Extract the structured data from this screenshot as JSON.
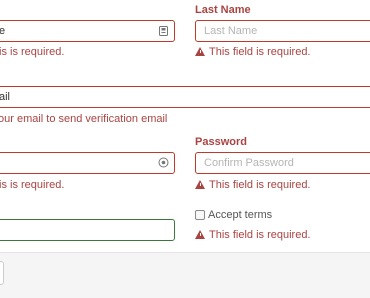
{
  "form": {
    "first_name": {
      "value": "e",
      "error": "is is required.",
      "icon": "id-card-icon"
    },
    "last_name": {
      "label": "Last Name",
      "placeholder": "Last Name",
      "error": "This field is required."
    },
    "email": {
      "value": "ail",
      "error": "our email to send verification email"
    },
    "password": {
      "value": "",
      "error": "is is required.",
      "icon": "eye-icon"
    },
    "confirm_password": {
      "label": "Password",
      "placeholder": "Confirm Password",
      "error": "This field is required."
    },
    "username": {
      "value": ""
    },
    "accept_terms": {
      "label": "Accept terms",
      "checked": false,
      "error": "This field is required."
    }
  },
  "colors": {
    "error": "#a94442",
    "error_border": "#c0392b",
    "valid_border": "#3c763d",
    "footer_bg": "#f5f5f5"
  }
}
